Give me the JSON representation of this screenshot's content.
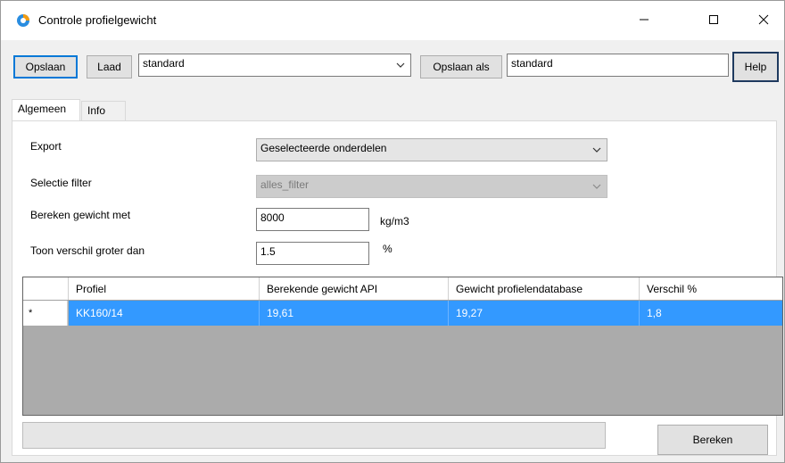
{
  "window": {
    "title": "Controle profielgewicht"
  },
  "toolbar": {
    "save_label": "Opslaan",
    "load_label": "Laad",
    "profile_selected": "standard",
    "save_as_label": "Opslaan als",
    "save_as_value": "standard",
    "help_label": "Help"
  },
  "tabs": [
    {
      "label": "Algemeen",
      "active": true
    },
    {
      "label": "Info",
      "active": false
    }
  ],
  "form": {
    "export_label": "Export",
    "export_value": "Geselecteerde onderdelen",
    "filter_label": "Selectie filter",
    "filter_value": "alles_filter",
    "weight_label": "Bereken gewicht met",
    "weight_value": "8000",
    "weight_unit": "kg/m3",
    "diff_label": "Toon verschil groter dan",
    "diff_value": "1.5",
    "diff_unit": "%"
  },
  "grid": {
    "columns": [
      "Profiel",
      "Berekende gewicht API",
      "Gewicht profielendatabase",
      "Verschil %"
    ],
    "rows": [
      {
        "marker": "*",
        "cells": [
          "KK160/14",
          "19,61",
          "19,27",
          "1,8"
        ],
        "selected": true
      }
    ]
  },
  "progress": {
    "value": 0
  },
  "footer": {
    "calculate_label": "Bereken"
  },
  "icons": {
    "app": "app-logo-icon",
    "minimize": "minimize-icon",
    "maximize": "maximize-icon",
    "close": "close-icon",
    "dropdown": "chevron-down-icon"
  },
  "colors": {
    "selection": "#3399ff",
    "focus": "#0078d7",
    "grid_background": "#ababab"
  }
}
